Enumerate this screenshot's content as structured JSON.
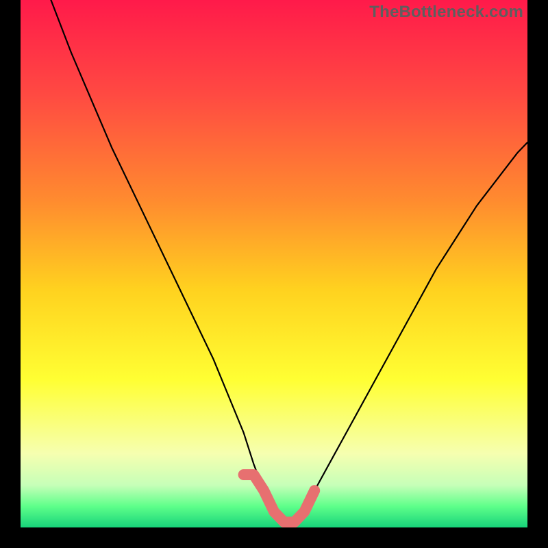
{
  "watermark": "TheBottleneck.com",
  "chart_data": {
    "type": "line",
    "title": "",
    "xlabel": "",
    "ylabel": "",
    "xlim": [
      0,
      100
    ],
    "ylim": [
      0,
      100
    ],
    "series": [
      {
        "name": "bottleneck-curve",
        "x": [
          6,
          10,
          14,
          18,
          22,
          26,
          30,
          34,
          38,
          41,
          44,
          46,
          48,
          50,
          52,
          54,
          56,
          58,
          62,
          66,
          70,
          74,
          78,
          82,
          86,
          90,
          94,
          98,
          100
        ],
        "y": [
          100,
          90,
          81,
          72,
          64,
          56,
          48,
          40,
          32,
          25,
          18,
          12,
          7,
          3,
          1,
          1,
          3,
          7,
          14,
          21,
          28,
          35,
          42,
          49,
          55,
          61,
          66,
          71,
          73
        ]
      }
    ],
    "bottom_band": {
      "name": "optimal-zone-marker",
      "color": "#e77070",
      "x_start": 44,
      "x_end": 58,
      "y": 3
    },
    "gradient_stops": [
      {
        "pct": 0,
        "color": "#ff1a4a"
      },
      {
        "pct": 18,
        "color": "#ff4a42"
      },
      {
        "pct": 38,
        "color": "#ff8b2f"
      },
      {
        "pct": 55,
        "color": "#ffd21f"
      },
      {
        "pct": 72,
        "color": "#ffff33"
      },
      {
        "pct": 86,
        "color": "#f6ffb0"
      },
      {
        "pct": 92,
        "color": "#c6ffb8"
      },
      {
        "pct": 96,
        "color": "#5eff8a"
      },
      {
        "pct": 100,
        "color": "#17d37a"
      }
    ]
  }
}
